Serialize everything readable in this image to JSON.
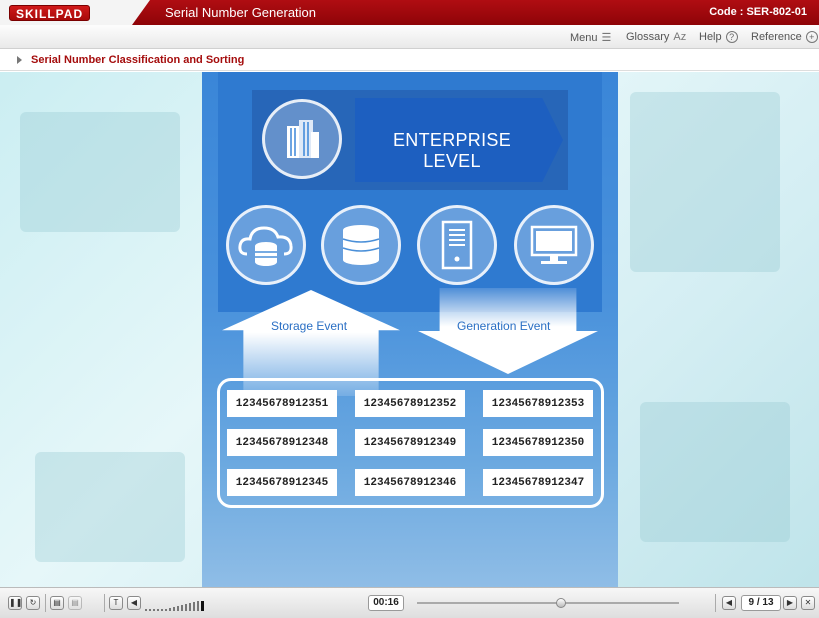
{
  "header": {
    "logo_text": "SKILLPAD",
    "title": "Serial Number Generation",
    "code": "Code :  SER-802-01"
  },
  "menu": [
    {
      "label": "Menu",
      "icon": "menu-lines-icon"
    },
    {
      "label": "Glossary",
      "icon": "glossary-az-icon",
      "icon_glyph": "Az"
    },
    {
      "label": "Help",
      "icon": "help-icon",
      "icon_glyph": "?"
    },
    {
      "label": "Reference",
      "icon": "reference-plus-icon",
      "icon_glyph": "+"
    }
  ],
  "breadcrumb": "Serial Number Classification and Sorting",
  "diagram": {
    "enterprise_label": "ENTERPRISE LEVEL",
    "icons": [
      "building-icon",
      "cloud-database-icon",
      "database-icon",
      "server-icon",
      "monitor-icon"
    ],
    "storage_label": "Storage Event",
    "generation_label": "Generation Event",
    "serials": [
      [
        "12345678912351",
        "12345678912352",
        "12345678912353"
      ],
      [
        "12345678912348",
        "12345678912349",
        "12345678912350"
      ],
      [
        "12345678912345",
        "12345678912346",
        "12345678912347"
      ]
    ]
  },
  "controls": {
    "time": "00:16",
    "pages": "9 / 13",
    "progress_fraction": 0.55
  },
  "colors": {
    "header_red": "#a50d0d",
    "panel_blue": "#2f7ad0",
    "arrow_blue": "#1d5fc0"
  }
}
